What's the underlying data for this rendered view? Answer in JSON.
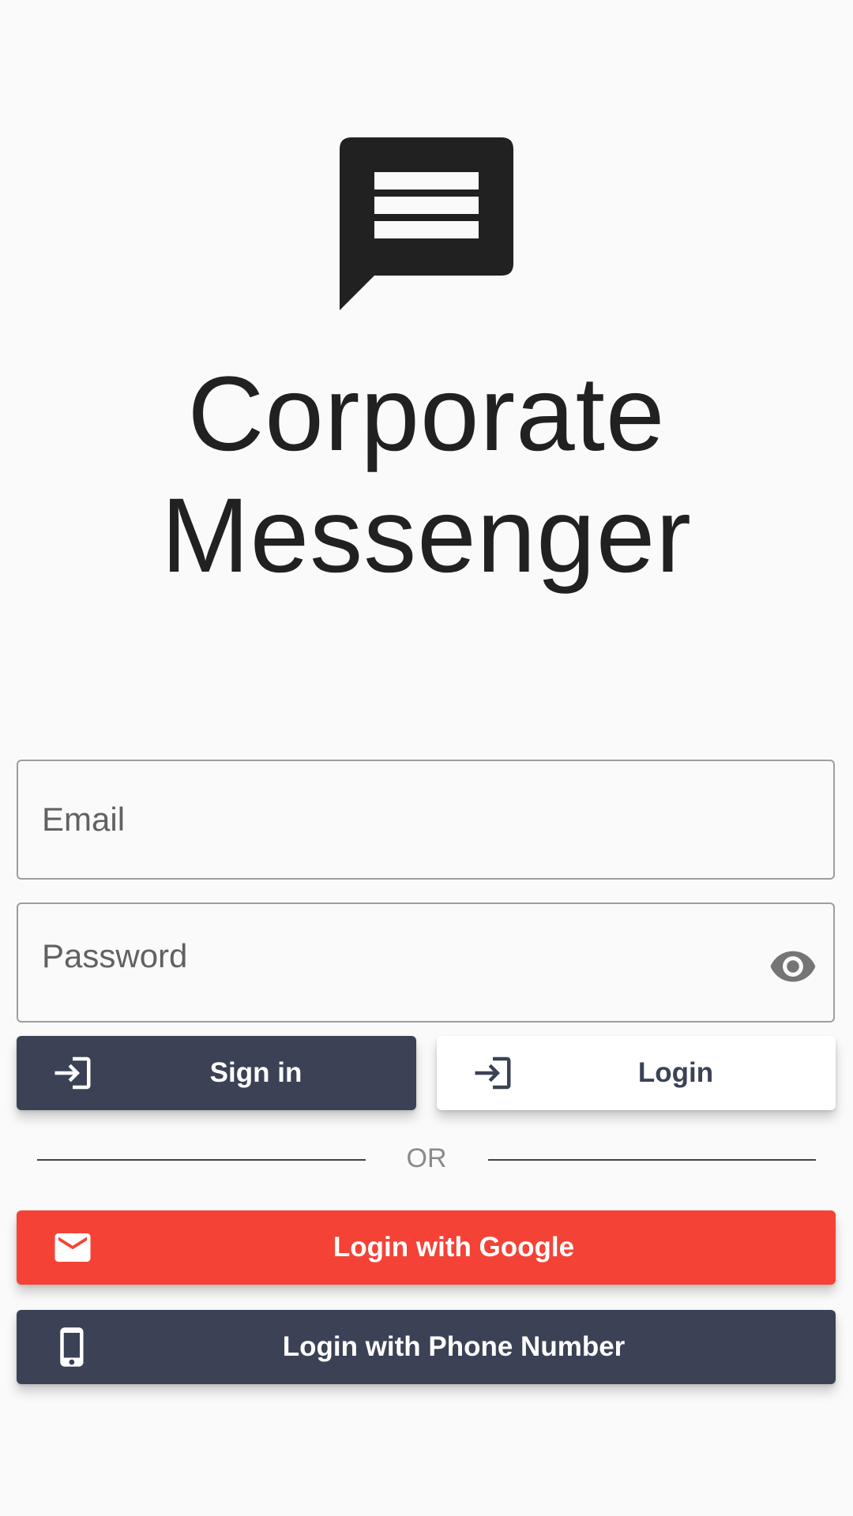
{
  "app": {
    "title_line1": "Corporate",
    "title_line2": "Messenger",
    "logo_icon": "chat-message-icon"
  },
  "form": {
    "email": {
      "placeholder": "Email",
      "value": ""
    },
    "password": {
      "placeholder": "Password",
      "value": "",
      "toggle_icon": "visibility-eye-icon"
    }
  },
  "buttons": {
    "sign_in": {
      "label": "Sign in",
      "icon": "login-icon"
    },
    "login": {
      "label": "Login",
      "icon": "login-icon"
    },
    "google": {
      "label": "Login with Google",
      "icon": "mail-icon"
    },
    "phone": {
      "label": "Login with Phone Number",
      "icon": "smartphone-icon"
    }
  },
  "divider": {
    "text": "OR"
  },
  "colors": {
    "background": "#fafafa",
    "primary_dark": "#3b4256",
    "google_red": "#f44336",
    "text_dark": "#212121"
  }
}
